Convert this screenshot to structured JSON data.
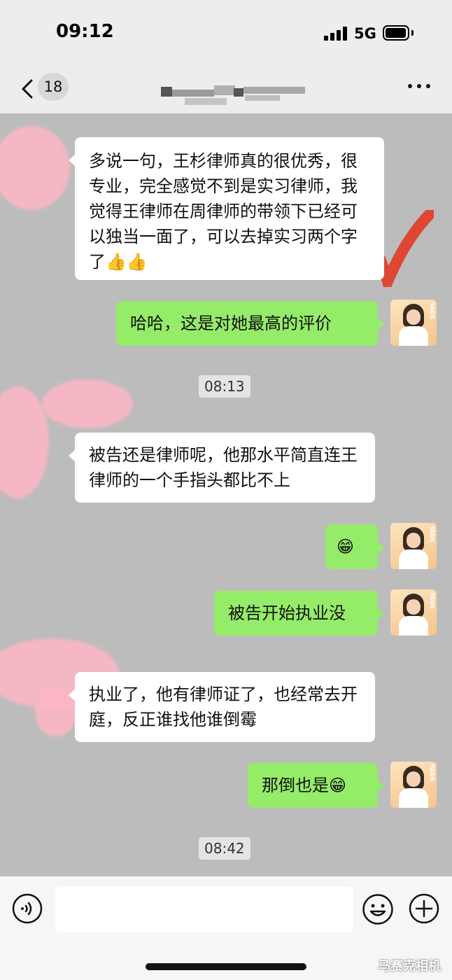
{
  "status_bar": {
    "time": "09:12",
    "network": "5G"
  },
  "nav": {
    "unread_count": "18"
  },
  "messages": [
    {
      "side": "in",
      "text": "多说一句，王杉律师真的很优秀，很专业，完全感觉不到是实习律师，我觉得王律师在周律师的带领下已经可以独当一面了，可以去掉实习两个字了👍👍"
    },
    {
      "side": "out",
      "text": "哈哈，这是对她最高的评价"
    },
    {
      "side": "in",
      "text": "被告还是律师呢，他那水平简直连王律师的一个手指头都比不上"
    },
    {
      "side": "out",
      "text": "😁"
    },
    {
      "side": "out",
      "text": "被告开始执业没"
    },
    {
      "side": "in",
      "text": "执业了，他有律师证了，也经常去开庭，反正谁找他谁倒霉"
    },
    {
      "side": "out",
      "text": "那倒也是😁"
    }
  ],
  "timestamps": [
    "08:13",
    "08:42"
  ],
  "avatar_text": "YAOS",
  "watermark": "马赛克相机",
  "colors": {
    "chat_bg": "#bcbcbc",
    "outgoing_bubble": "#95ec69",
    "incoming_bubble": "#ffffff"
  }
}
